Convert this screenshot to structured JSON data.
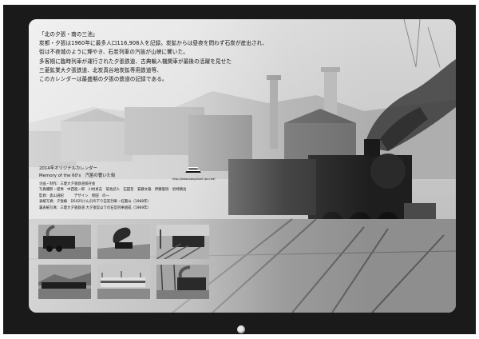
{
  "heading": "「北の夕張・南の三池」",
  "body_lines": [
    "炭都・夕張は1960年に最多人口116,908人を記録。炭鉱からは昼夜を問わず石炭が産出され、",
    "街は不夜城のように輝やき、石炭列車の汽笛が山峡に響いた。",
    "多客期に臨時列車が運行された夕張鉄道、古典輸入機関車が最後の活躍を見せた",
    "三菱鉱業大夕張鉄道、北炭真谷地炭鉱専用鉄道等、",
    "このカレンダーは最盛期の夕張の鉄道の記録である。"
  ],
  "subtitle_line1": "2014年オリジナルカレンダー",
  "subtitle_line2": "Memory of the 60's　汽笛の響いた街",
  "credits": [
    "企画・制作：三菱大夕張鉄道保存会",
    "写真撮影・提供　中西進一郎　川村貞志　菊池武人　石田哲　安藤文雄　伊藤俊則　岩崎慎治",
    "監修：奥山道紀　　　デザイン　修田　の一",
    "表紙写真：夕張線　D5025けん引の下り石炭列車・紅葉山（1968年）",
    "裏表紙写真：三菱大夕張鉄道 大夕張炭山での石炭列車組成（1969年）"
  ],
  "logo_url": "http://www.oosyubari-rps.net/",
  "icons": {
    "logo": "railway-society-emblem-icon",
    "binding_hole": "binding-hole-icon"
  },
  "colors": {
    "sheet_background": "#1a1a1a",
    "card_background": "#c9c9c9",
    "text": "#111111"
  }
}
